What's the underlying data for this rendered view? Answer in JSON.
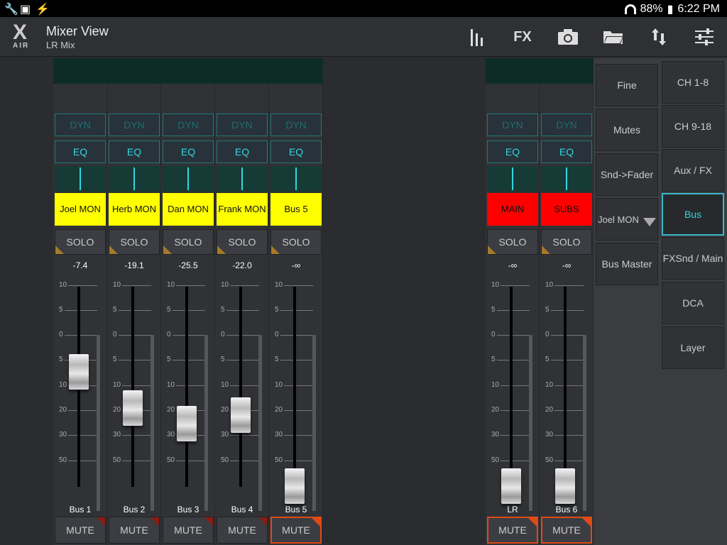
{
  "status": {
    "battery": "88%",
    "time": "6:22 PM"
  },
  "app": {
    "logo_text": "X",
    "logo_sub": "AIR",
    "title": "Mixer View",
    "subtitle": "LR Mix"
  },
  "toolbar": {
    "fx_label": "FX"
  },
  "strip_labels": {
    "dyn": "DYN",
    "eq": "EQ",
    "solo": "SOLO",
    "mute": "MUTE"
  },
  "scale": [
    "10",
    "5",
    "0",
    "5",
    "10",
    "20",
    "30",
    "50"
  ],
  "channels": [
    {
      "name": "Joel MON",
      "color": "#ffff00",
      "level": "-7.4",
      "label": "Bus 1",
      "fader_db": -7.4,
      "mute_active": false
    },
    {
      "name": "Herb MON",
      "color": "#ffff00",
      "level": "-19.1",
      "label": "Bus 2",
      "fader_db": -19.1,
      "mute_active": false
    },
    {
      "name": "Dan MON",
      "color": "#ffff00",
      "level": "-25.5",
      "label": "Bus 3",
      "fader_db": -25.5,
      "mute_active": false
    },
    {
      "name": "Frank MON",
      "color": "#ffff00",
      "level": "-22.0",
      "label": "Bus 4",
      "fader_db": -22.0,
      "mute_active": false
    },
    {
      "name": "Bus 5",
      "color": "#ffff00",
      "level": "-∞",
      "label": "Bus 5",
      "fader_db": null,
      "mute_active": true
    }
  ],
  "masters": [
    {
      "name": "MAIN",
      "color": "#ff0000",
      "level": "-∞",
      "label": "LR",
      "fader_db": null,
      "mute_active": true
    },
    {
      "name": "SUBS",
      "color": "#ff0000",
      "level": "-∞",
      "label": "Bus 6",
      "fader_db": null,
      "mute_active": true
    }
  ],
  "side_panel": {
    "col1": [
      "Fine",
      "Mutes",
      "Snd->Fader",
      "Joel MON",
      "Bus Master"
    ],
    "col2": [
      "CH 1-8",
      "CH 9-18",
      "Aux / FX",
      "Bus",
      "FXSnd / Main",
      "DCA",
      "Layer"
    ],
    "selected": "Bus"
  },
  "colors": {
    "accent": "#34d6e0",
    "mute_active": "#e04a16"
  }
}
